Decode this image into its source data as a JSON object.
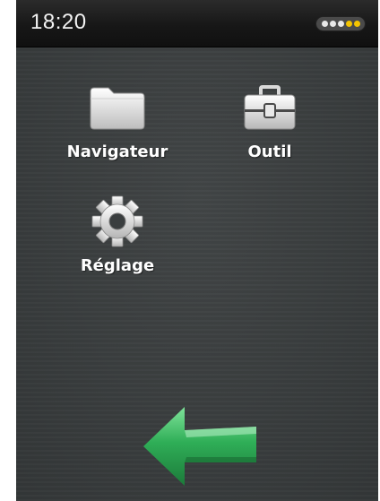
{
  "status_bar": {
    "time": "18:20",
    "signal_dots": [
      "on-white",
      "on-white",
      "on-white",
      "on-yellow",
      "on-yellow"
    ]
  },
  "apps": [
    {
      "label": "Navigateur",
      "icon": "folder-icon"
    },
    {
      "label": "Outil",
      "icon": "toolbox-icon"
    },
    {
      "label": "Réglage",
      "icon": "gear-icon"
    }
  ],
  "navigation": {
    "back_icon": "back-arrow-icon"
  },
  "colors": {
    "background": "#3a3e3f",
    "status_bar": "#151515",
    "text": "#ffffff",
    "signal_active": "#f4c400",
    "arrow_green": "#2fae57"
  }
}
